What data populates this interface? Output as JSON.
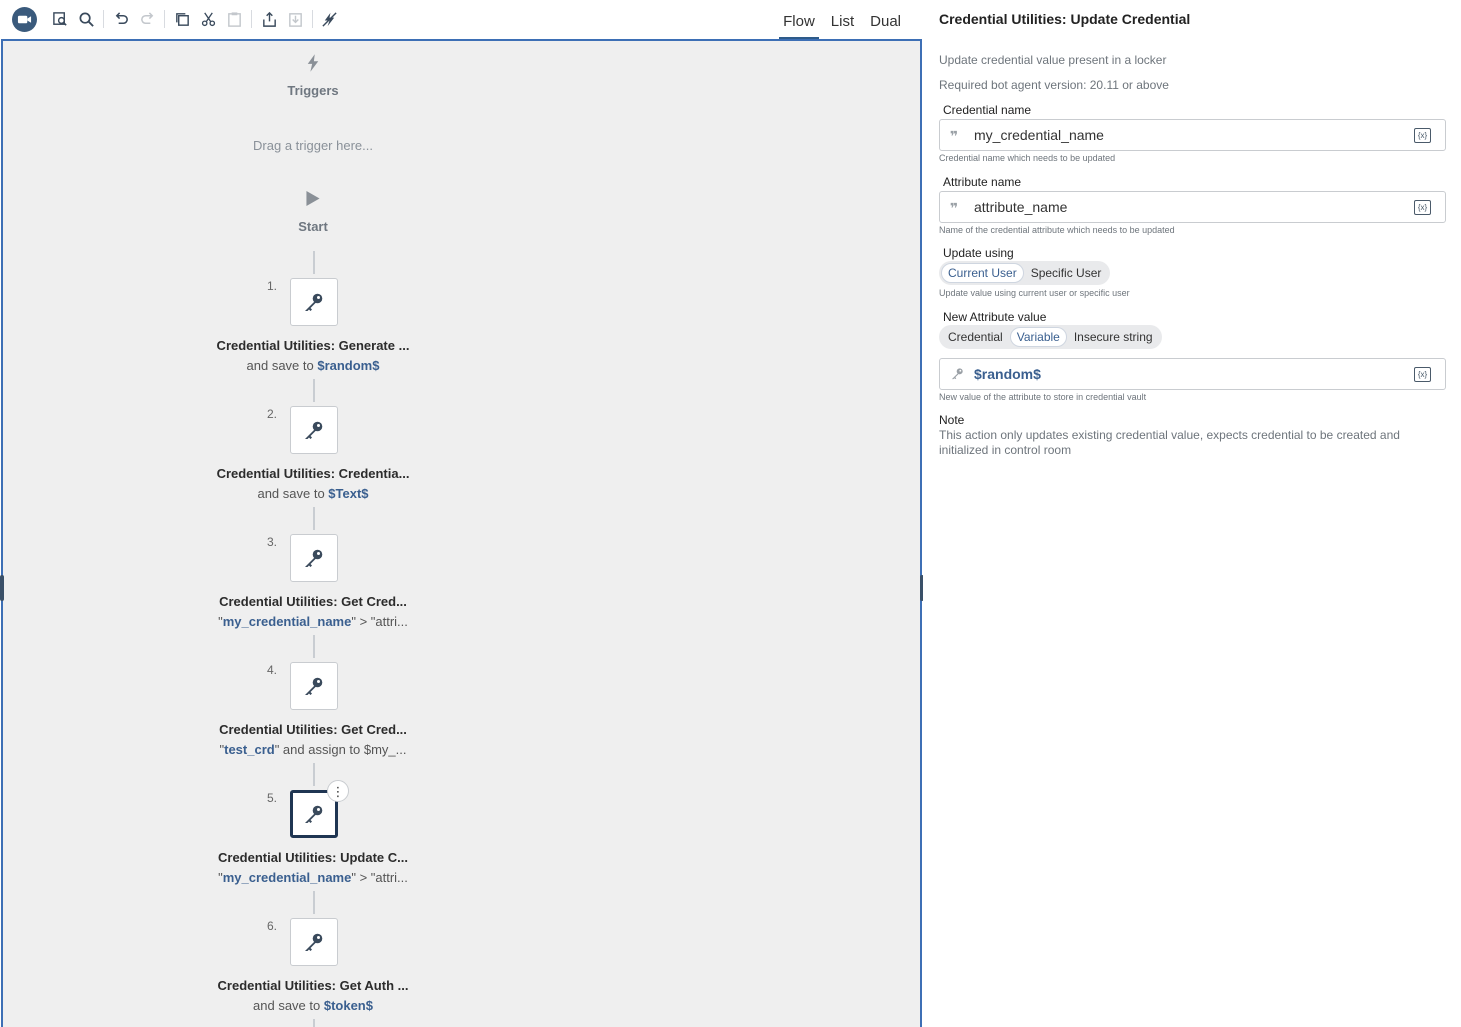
{
  "toolbar": {
    "view_tabs": [
      "Flow",
      "List",
      "Dual"
    ],
    "active_view": "Flow"
  },
  "flow": {
    "triggers_label": "Triggers",
    "drag_hint": "Drag a trigger here...",
    "start_label": "Start",
    "steps": [
      {
        "number": "1.",
        "title": "Credential Utilities: Generate ...",
        "sub_prefix": "and save to ",
        "sub_var": "$random$",
        "sub_suffix": ""
      },
      {
        "number": "2.",
        "title": "Credential Utilities: Credentia...",
        "sub_prefix": "and save to ",
        "sub_var": "$Text$",
        "sub_suffix": ""
      },
      {
        "number": "3.",
        "title": "Credential Utilities: Get Cred...",
        "sub_prefix": "\"",
        "sub_var": "my_credential_name",
        "sub_suffix": "\" > \"attri..."
      },
      {
        "number": "4.",
        "title": "Credential Utilities: Get Cred...",
        "sub_prefix": "\"",
        "sub_var": "test_crd",
        "sub_suffix": "\" and assign to $my_..."
      },
      {
        "number": "5.",
        "title": "Credential Utilities: Update C...",
        "sub_prefix": "\"",
        "sub_var": "my_credential_name",
        "sub_suffix": "\" > \"attri..."
      },
      {
        "number": "6.",
        "title": "Credential Utilities: Get Auth ...",
        "sub_prefix": "and save to ",
        "sub_var": "$token$",
        "sub_suffix": ""
      }
    ],
    "selected_step": "5."
  },
  "panel": {
    "title": "Credential Utilities: Update Credential",
    "description": "Update credential value present in a locker",
    "version_note": "Required bot agent version: 20.11 or above",
    "credential_name": {
      "label": "Credential name",
      "value": "my_credential_name",
      "hint": "Credential name which needs to be updated"
    },
    "attribute_name": {
      "label": "Attribute name",
      "value": "attribute_name",
      "hint": "Name of the credential attribute which needs to be updated"
    },
    "update_using": {
      "label": "Update using",
      "options": [
        "Current User",
        "Specific User"
      ],
      "selected": "Current User",
      "hint": "Update value using current user or specific user"
    },
    "new_value": {
      "label": "New Attribute value",
      "options": [
        "Credential",
        "Variable",
        "Insecure string"
      ],
      "selected": "Variable",
      "value": "$random$",
      "hint": "New value of the attribute to store in credential vault"
    },
    "note": {
      "title": "Note",
      "text": "This action only updates existing credential value, expects credential to be created and initialized in control room"
    },
    "var_button_label": "{x}",
    "quote_glyph": "❞"
  },
  "colors": {
    "accent": "#3a5f8f",
    "canvas_border": "#3d6fb5",
    "canvas_bg": "#efefef",
    "selected_border": "#1f3552"
  }
}
